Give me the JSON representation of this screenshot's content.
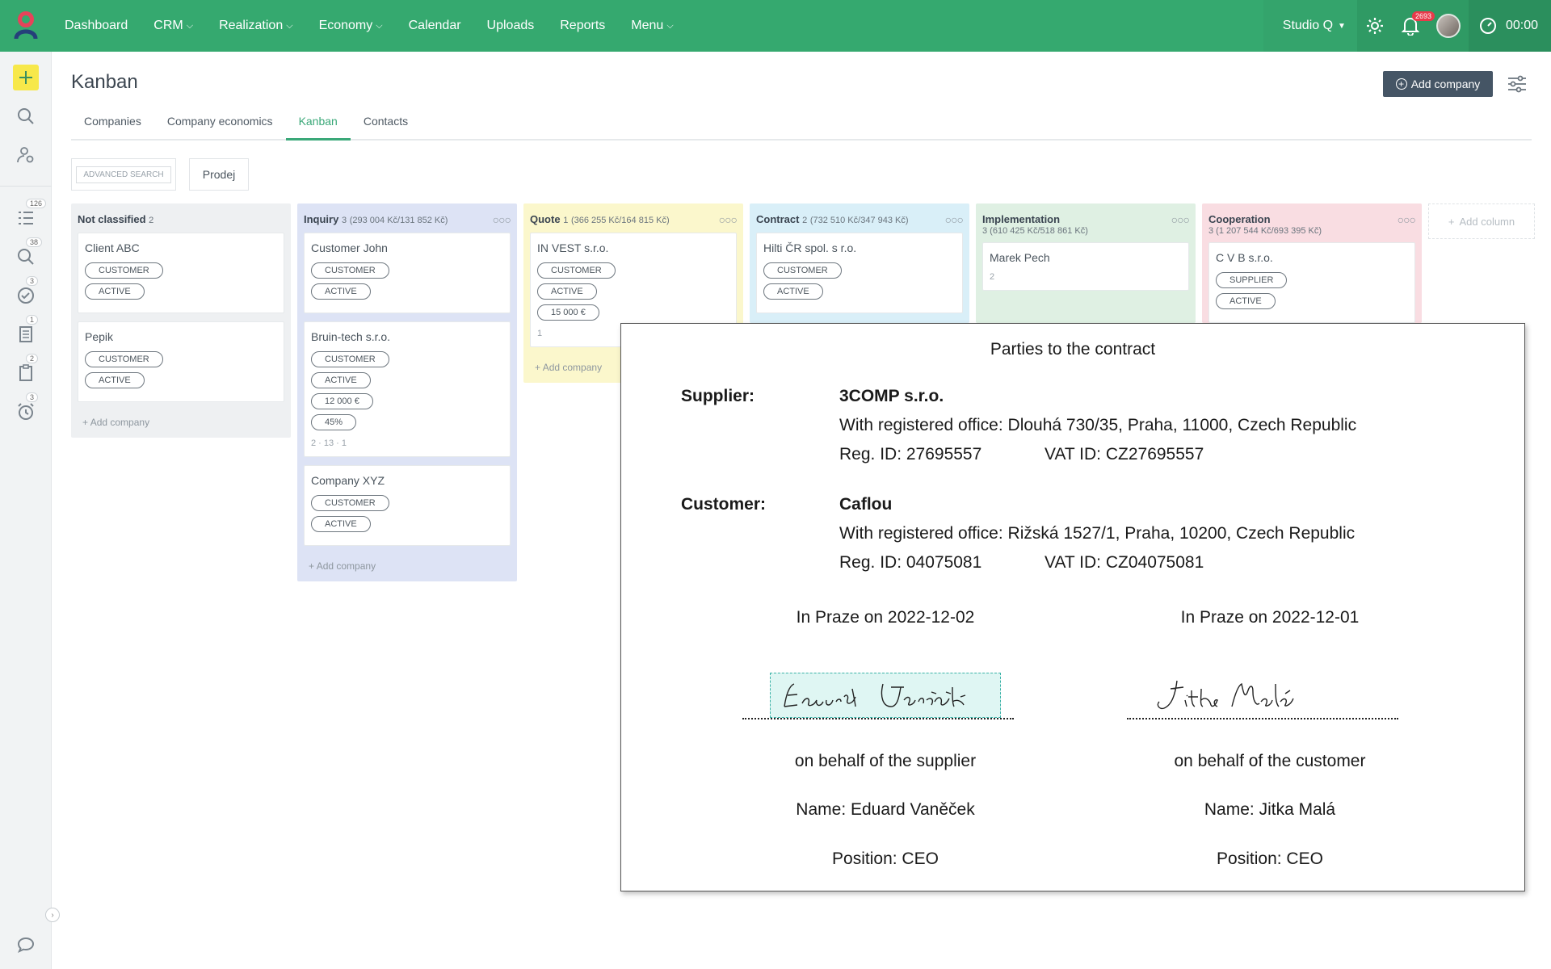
{
  "nav": {
    "items": [
      {
        "label": "Dashboard",
        "caret": false
      },
      {
        "label": "CRM",
        "caret": true
      },
      {
        "label": "Realization",
        "caret": true
      },
      {
        "label": "Economy",
        "caret": true
      },
      {
        "label": "Calendar",
        "caret": false
      },
      {
        "label": "Uploads",
        "caret": false
      },
      {
        "label": "Reports",
        "caret": false
      },
      {
        "label": "Menu",
        "caret": true
      }
    ],
    "studio": "Studio Q",
    "notif_count": "2693",
    "timer": "00:00"
  },
  "sidebar": {
    "badges": {
      "tasks": "126",
      "search": "38",
      "done": "3",
      "docs": "1",
      "clip": "2",
      "alarm": "3"
    }
  },
  "page": {
    "title": "Kanban",
    "add_company": "Add company",
    "tabs": [
      "Companies",
      "Company economics",
      "Kanban",
      "Contacts"
    ],
    "active_tab": "Kanban",
    "advanced_search": "ADVANCED SEARCH",
    "filter_chip": "Prodej"
  },
  "kanban": {
    "add_company_label": "Add company",
    "add_column_label": "Add column",
    "columns": [
      {
        "title": "Not classified",
        "count": "2",
        "summary": "",
        "bg": "#eef0f2",
        "cards": [
          {
            "title": "Client ABC",
            "tags": [
              "CUSTOMER",
              "ACTIVE"
            ],
            "meta": ""
          },
          {
            "title": "Pepik",
            "tags": [
              "CUSTOMER",
              "ACTIVE"
            ],
            "meta": ""
          }
        ]
      },
      {
        "title": "Inquiry",
        "count": "3",
        "summary": "(293 004 Kč/131 852 Kč)",
        "bg": "#dde3f5",
        "cards": [
          {
            "title": "Customer John",
            "tags": [
              "CUSTOMER",
              "ACTIVE"
            ],
            "meta": ""
          },
          {
            "title": "Bruin-tech s.r.o.",
            "tags": [
              "CUSTOMER",
              "ACTIVE",
              "12 000 €",
              "45%"
            ],
            "meta": "2 · 13 · 1"
          },
          {
            "title": "Company XYZ",
            "tags": [
              "CUSTOMER",
              "ACTIVE"
            ],
            "meta": ""
          }
        ]
      },
      {
        "title": "Quote",
        "count": "1",
        "summary": "(366 255 Kč/164 815 Kč)",
        "bg": "#fbf7cc",
        "cards": [
          {
            "title": "IN VEST s.r.o.",
            "tags": [
              "CUSTOMER",
              "ACTIVE",
              "15 000 €"
            ],
            "meta": "1"
          }
        ]
      },
      {
        "title": "Contract",
        "count": "2",
        "summary": "(732 510 Kč/347 943 Kč)",
        "bg": "#d9eff8",
        "cards": [
          {
            "title": "Hilti ČR spol. s r.o.",
            "tags": [
              "CUSTOMER",
              "ACTIVE"
            ],
            "meta": ""
          }
        ]
      },
      {
        "title": "Implementation",
        "count": "",
        "summary": "3 (610 425 Kč/518 861 Kč)",
        "bg": "#dff0e3",
        "cards": [
          {
            "title": "Marek Pech",
            "tags": [],
            "meta": "2"
          }
        ]
      },
      {
        "title": "Cooperation",
        "count": "",
        "summary": "3 (1 207 544 Kč/693 395 Kč)",
        "bg": "#f9dde2",
        "cards": [
          {
            "title": "C V B s.r.o.",
            "tags": [
              "SUPPLIER",
              "ACTIVE"
            ],
            "meta": ""
          }
        ]
      }
    ]
  },
  "contract": {
    "title": "Parties to the contract",
    "supplier": {
      "label": "Supplier:",
      "name": "3COMP s.r.o.",
      "office": "With registered office: Dlouhá 730/35, Praha, 11000, Czech Republic",
      "reg_id": "Reg. ID: 27695557",
      "vat_id": "VAT ID: CZ27695557"
    },
    "customer": {
      "label": "Customer:",
      "name": "Caflou",
      "office": "With registered office: Rižská 1527/1, Praha, 10200, Czech Republic",
      "reg_id": "Reg. ID: 04075081",
      "vat_id": "VAT ID: CZ04075081"
    },
    "left": {
      "place_date": "In Praze on 2022-12-02",
      "signature": "Eduard Vaněček",
      "behalf": "on behalf of the supplier",
      "name": "Name: Eduard Vaněček",
      "position": "Position: CEO"
    },
    "right": {
      "place_date": "In Praze on 2022-12-01",
      "signature": "Jitka Malá",
      "behalf": "on behalf of the customer",
      "name": "Name: Jitka Malá",
      "position": "Position: CEO"
    }
  },
  "colors": {
    "brand": "#35a96f",
    "accent_tab": "#3aa878",
    "button_dark": "#455565"
  }
}
